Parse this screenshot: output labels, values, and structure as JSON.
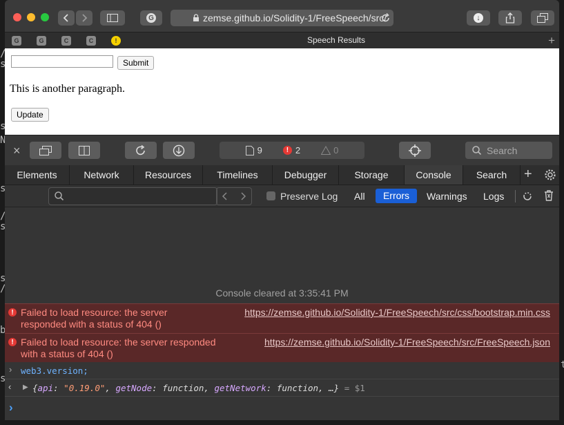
{
  "browser": {
    "url": "zemse.github.io/Solidity-1/FreeSpeech/src/",
    "tab_title": "Speech Results",
    "favicons": [
      "G",
      "G",
      "C",
      "C",
      "!"
    ]
  },
  "page": {
    "input_value": "",
    "submit_label": "Submit",
    "paragraph": "This is another paragraph.",
    "update_label": "Update"
  },
  "devtools": {
    "resource_count": "9",
    "error_count": "2",
    "warning_count": "0",
    "search_placeholder": "Search",
    "tabs": [
      "Elements",
      "Network",
      "Resources",
      "Timelines",
      "Debugger",
      "Storage",
      "Console",
      "Search"
    ],
    "preserve_log_label": "Preserve Log",
    "filters": [
      "All",
      "Errors",
      "Warnings",
      "Logs"
    ],
    "active_filter": "Errors",
    "accent": "#1a5fd6"
  },
  "console": {
    "cleared": "Console cleared at 3:35:41 PM",
    "errors": [
      {
        "line1": "Failed to load resource: the server",
        "line2": "responded with a status of 404 ()",
        "url": "https://zemse.github.io/Solidity-1/FreeSpeech/src/css/bootstrap.min.css"
      },
      {
        "line1": "Failed to load resource: the server responded",
        "line2": "with a status of 404 ()",
        "url": "https://zemse.github.io/Solidity-1/FreeSpeech/src/FreeSpeech.json"
      }
    ],
    "input_cmd": "web3.version;",
    "output": {
      "open": "{",
      "k1": "api",
      "v1": "\"0.19.0\"",
      "k2": "getNode",
      "v2": "function",
      "k3": "getNetwork",
      "v3": "function",
      "rest": "…}",
      "var": "= $1"
    }
  }
}
